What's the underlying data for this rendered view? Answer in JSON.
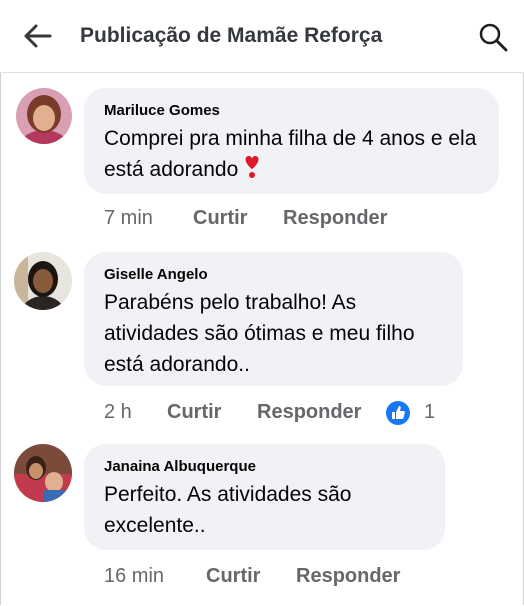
{
  "header": {
    "title": "Publicação de Mamãe Reforça"
  },
  "comments": [
    {
      "author": "Mariluce Gomes",
      "text": "Comprei pra minha filha de 4 anos e ela está adorando",
      "time": "7 min",
      "like_label": "Curtir",
      "reply_label": "Responder",
      "emoji": "heart-exclamation"
    },
    {
      "author": "Giselle Angelo",
      "text": "Parabéns pelo trabalho! As atividades são ótimas e meu filho está adorando..",
      "time": "2 h",
      "like_label": "Curtir",
      "reply_label": "Responder",
      "reaction_count": "1",
      "reaction_icon": "like-icon"
    },
    {
      "author": "Janaina Albuquerque",
      "text": "Perfeito. As atividades são excelente..",
      "time": "16 min",
      "like_label": "Curtir",
      "reply_label": "Responder"
    }
  ],
  "colors": {
    "bubble": "#f0f2f5",
    "meta": "#65676b",
    "like_blue": "#1877f2",
    "heart_red": "#e0162b"
  }
}
